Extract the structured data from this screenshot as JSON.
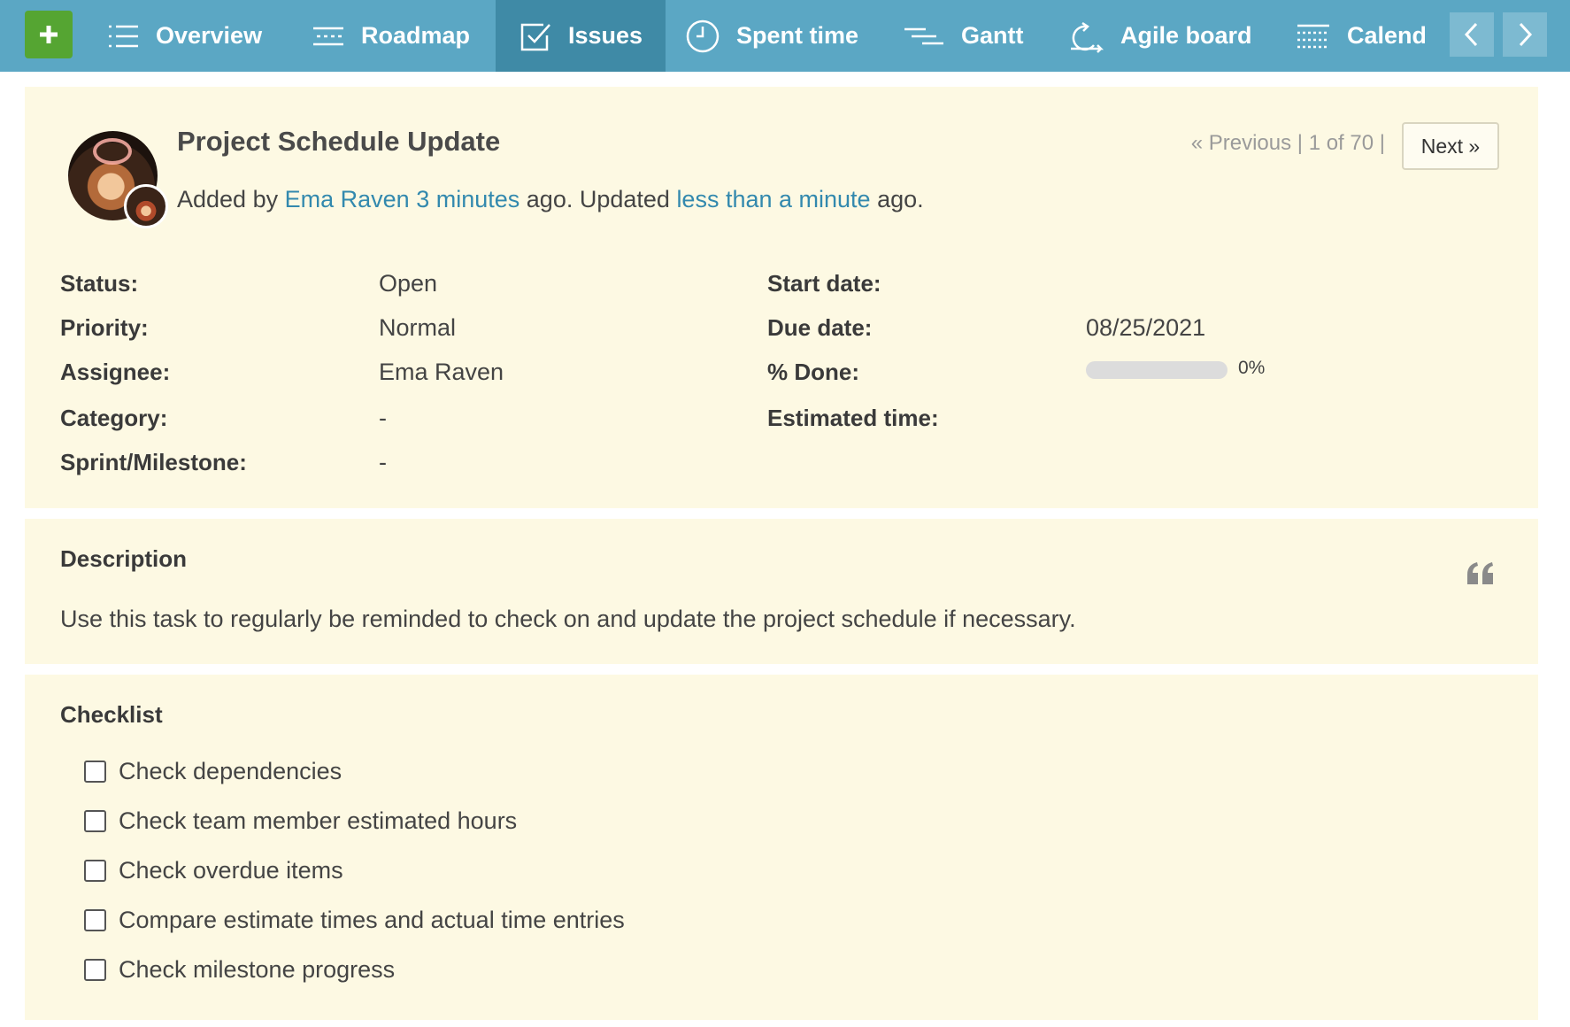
{
  "nav": {
    "tabs": [
      {
        "label": "Overview",
        "icon": "list-icon"
      },
      {
        "label": "Roadmap",
        "icon": "roadmap-icon"
      },
      {
        "label": "Issues",
        "icon": "checkbox-icon",
        "active": true
      },
      {
        "label": "Spent time",
        "icon": "clock-icon"
      },
      {
        "label": "Gantt",
        "icon": "gantt-icon"
      },
      {
        "label": "Agile board",
        "icon": "agile-icon"
      },
      {
        "label": "Calend",
        "icon": "calendar-icon"
      }
    ],
    "add_icon": "plus-icon",
    "scroll_left_icon": "chevron-left-icon",
    "scroll_right_icon": "chevron-right-icon"
  },
  "issue": {
    "title": "Project Schedule Update",
    "added_by_prefix": "Added by",
    "author": "Ema Raven",
    "created_ago": "3 minutes",
    "created_suffix": "ago. Updated",
    "updated_ago": "less than a minute",
    "updated_suffix": "ago."
  },
  "pager": {
    "previous_label": "« Previous",
    "position": "1 of 70",
    "next_label": "Next »"
  },
  "attributes": {
    "left": [
      {
        "label": "Status:",
        "value": "Open"
      },
      {
        "label": "Priority:",
        "value": "Normal"
      },
      {
        "label": "Assignee:",
        "value": "Ema Raven"
      },
      {
        "label": "Category:",
        "value": "-"
      },
      {
        "label": "Sprint/Milestone:",
        "value": "-"
      }
    ],
    "right": [
      {
        "label": "Start date:",
        "value": ""
      },
      {
        "label": "Due date:",
        "value": "08/25/2021"
      },
      {
        "label": "% Done:",
        "value": "0%"
      },
      {
        "label": "Estimated time:",
        "value": ""
      }
    ],
    "done_fraction": 0
  },
  "description": {
    "title": "Description",
    "text": "Use this task to regularly be reminded to check on and update the project schedule if necessary.",
    "quote_icon": "quote-icon"
  },
  "checklist": {
    "title": "Checklist",
    "items": [
      {
        "label": "Check dependencies",
        "checked": false
      },
      {
        "label": "Check team member estimated hours",
        "checked": false
      },
      {
        "label": "Check overdue items",
        "checked": false
      },
      {
        "label": "Compare estimate times and actual time entries",
        "checked": false
      },
      {
        "label": "Check milestone progress",
        "checked": false
      }
    ]
  },
  "colors": {
    "nav_bg": "#5ba7c4",
    "nav_active": "#3f8aa6",
    "add_button": "#55a532",
    "panel_bg": "#fdf9e3",
    "link": "#3389ae"
  }
}
